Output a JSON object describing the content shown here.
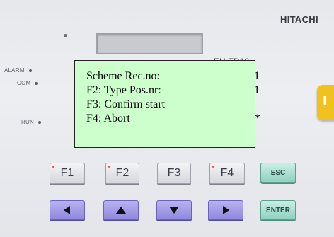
{
  "device": {
    "brand": "HITACHI",
    "model": "EH-TD10",
    "leds": {
      "alarm": "ALARM",
      "com": "COM",
      "run": "RUN"
    },
    "info_key": "i"
  },
  "screen": {
    "background": "#ccffcc",
    "rows": [
      {
        "label": "Scheme  Rec.no:",
        "value": "1"
      },
      {
        "label": "F2: Type Pos.nr:",
        "value": "1"
      },
      {
        "label": "F3: Confirm start",
        "value": ""
      },
      {
        "label": "F4: Abort",
        "value": "*"
      }
    ]
  },
  "keys": {
    "f1": "F1",
    "f2": "F2",
    "f3": "F3",
    "f4": "F4",
    "esc": "ESC",
    "enter": "ENTER",
    "left": "left-arrow-icon",
    "up": "up-arrow-icon",
    "down": "down-arrow-icon",
    "right": "right-arrow-icon"
  }
}
